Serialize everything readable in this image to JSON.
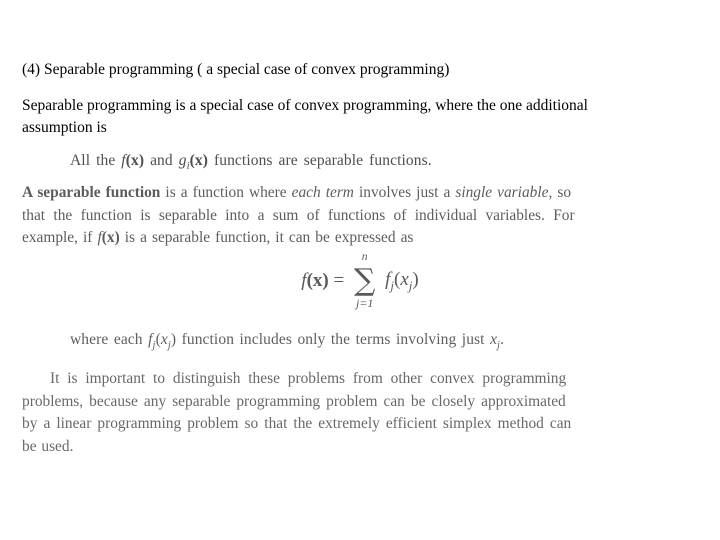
{
  "document": {
    "background_color": "#ffffff",
    "text_color": "#000000",
    "scan_text_color": "#3d3d3d"
  },
  "typed": {
    "title": "(4) Separable programming ( a special case of convex programming)",
    "paragraph": "Separable programming is a special case of convex programming, where the one additional assumption is"
  },
  "scanned": {
    "statement": {
      "prefix": "All the ",
      "f_italic": "f",
      "f_arg": "(x)",
      "middle": " and ",
      "g_italic": "g",
      "g_sub": "i",
      "g_arg": "(x)",
      "suffix": " functions are separable functions."
    },
    "definition": {
      "line1_bold": "A separable function",
      "line1_a": " is a function where ",
      "line1_italic1": "each term",
      "line1_b": " involves just a ",
      "line1_italic2": "single variable",
      "line1_c": ", so",
      "line2": "that the function is separable into a sum of functions of individual variables. For",
      "line3_a": "example, if ",
      "line3_f": "f",
      "line3_arg": "(x)",
      "line3_b": " is a separable function, it can be expressed as"
    },
    "equation": {
      "lhs_f": "f",
      "lhs_arg": "(x)",
      "equals": " = ",
      "sigma": "∑",
      "sigma_upper": "n",
      "sigma_lower": "j=1",
      "term_f": "f",
      "term_sub": "j",
      "term_open": "(",
      "term_x": "x",
      "term_xsub": "j",
      "term_close": ")"
    },
    "where_note": {
      "a": "where each ",
      "f": "f",
      "f_sub": "j",
      "arg_open": "(",
      "arg_x": "x",
      "arg_sub": "j",
      "arg_close": ")",
      "b": " function includes only the terms involving just ",
      "x": "x",
      "x_sub": "j",
      "period": "."
    },
    "closing": {
      "line1": "It is important to distinguish these problems from other convex programming",
      "line2": "problems, because any separable programming problem can be closely approximated",
      "line3": "by a linear programming problem so that the extremely efficient simplex method can",
      "line4": "be used."
    }
  }
}
